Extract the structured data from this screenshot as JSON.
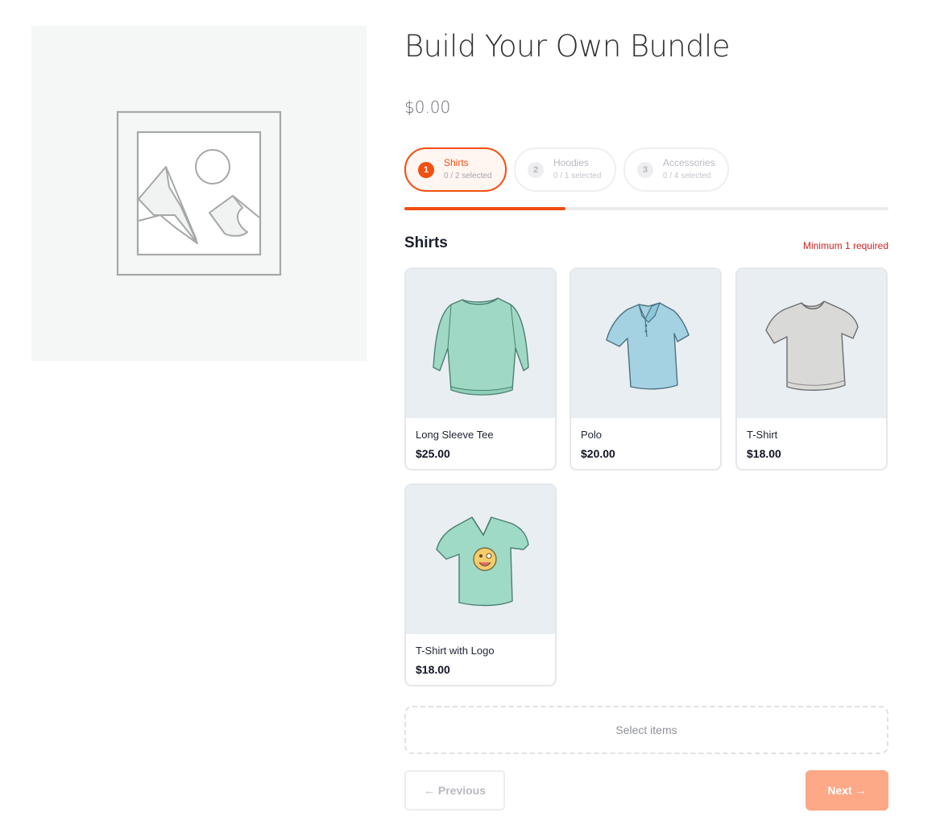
{
  "product": {
    "title": "Build Your Own Bundle",
    "price": "$0.00",
    "image_icon": "image-placeholder-icon"
  },
  "steps": [
    {
      "num": "1",
      "label": "Shirts",
      "sub": "0 / 2 selected",
      "active": true
    },
    {
      "num": "2",
      "label": "Hoodies",
      "sub": "0 / 1 selected",
      "active": false
    },
    {
      "num": "3",
      "label": "Accessories",
      "sub": "0 / 4 selected",
      "active": false
    }
  ],
  "progress": {
    "fraction": 0.333
  },
  "section": {
    "title": "Shirts",
    "requirement": "Minimum 1 required"
  },
  "products": [
    {
      "name": "Long Sleeve Tee",
      "price": "$25.00",
      "image": "long-sleeve-tee-illustration"
    },
    {
      "name": "Polo",
      "price": "$20.00",
      "image": "polo-shirt-illustration"
    },
    {
      "name": "T-Shirt",
      "price": "$18.00",
      "image": "tshirt-illustration"
    },
    {
      "name": "T-Shirt with Logo",
      "price": "$18.00",
      "image": "tshirt-logo-illustration"
    }
  ],
  "selection": {
    "placeholder": "Select items"
  },
  "nav": {
    "previous": "← Previous",
    "next": "Next →"
  },
  "colors": {
    "accent": "#f24f11",
    "next_button": "#fda887",
    "required": "#d62020"
  }
}
